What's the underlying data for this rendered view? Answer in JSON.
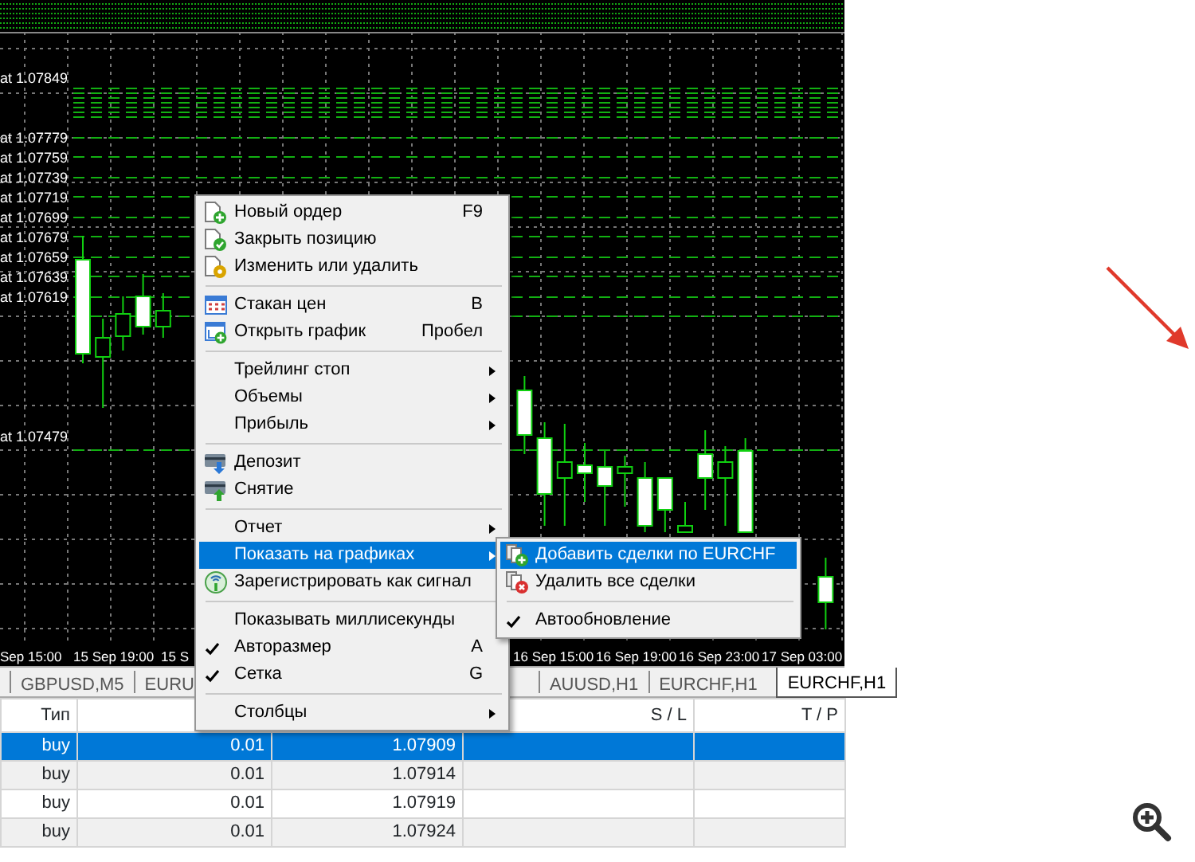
{
  "chart": {
    "price_labels": [
      "at 1.07849",
      "at 1.07779",
      "at 1.07759",
      "at 1.07739",
      "at 1.07719",
      "at 1.07699",
      "at 1.07679",
      "at 1.07659",
      "at 1.07639",
      "at 1.07619",
      "at 1.07479"
    ],
    "time_labels": [
      "Sep 15:00",
      "15 Sep 19:00",
      "15 S",
      "16 Sep 15:00",
      "16 Sep 19:00",
      "16 Sep 23:00",
      "17 Sep 03:00"
    ]
  },
  "tabs": [
    {
      "label": "GBPUSD,M5",
      "selected": false
    },
    {
      "label": "EURU",
      "selected": false
    },
    {
      "label": "AUUSD,H1",
      "selected": false
    },
    {
      "label": "EURCHF,H1",
      "selected": false
    },
    {
      "label": "EURCHF,H1",
      "selected": true
    }
  ],
  "table": {
    "header": {
      "column_1": "Тип",
      "column_4": "S / L",
      "column_5": "T / P"
    },
    "rows": [
      {
        "column_1": "buy",
        "column_2": "0.01",
        "column_3": "1.07909",
        "selected": true
      },
      {
        "column_1": "buy",
        "column_2": "0.01",
        "column_3": "1.07914",
        "selected": false
      },
      {
        "column_1": "buy",
        "column_2": "0.01",
        "column_3": "1.07919",
        "selected": false
      },
      {
        "column_1": "buy",
        "column_2": "0.01",
        "column_3": "1.07924",
        "selected": false
      }
    ]
  },
  "menu": {
    "items": [
      {
        "kind": "item",
        "label": "Новый ордер",
        "shortcut": "F9",
        "submenu": false,
        "checked": false,
        "selected": false
      },
      {
        "kind": "item",
        "label": "Закрыть позицию",
        "submenu": false,
        "checked": false,
        "selected": false
      },
      {
        "kind": "item",
        "label": "Изменить или удалить",
        "submenu": false,
        "checked": false,
        "selected": false
      },
      {
        "kind": "separator"
      },
      {
        "kind": "item",
        "label": "Стакан цен",
        "shortcut": "B",
        "submenu": false,
        "checked": false,
        "selected": false
      },
      {
        "kind": "item",
        "label": "Открыть график",
        "shortcut": "Пробел",
        "submenu": false,
        "checked": false,
        "selected": false
      },
      {
        "kind": "separator"
      },
      {
        "kind": "item",
        "label": "Трейлинг стоп",
        "submenu": true,
        "checked": false,
        "selected": false
      },
      {
        "kind": "item",
        "label": "Объемы",
        "submenu": true,
        "checked": false,
        "selected": false
      },
      {
        "kind": "item",
        "label": "Прибыль",
        "submenu": true,
        "checked": false,
        "selected": false
      },
      {
        "kind": "separator"
      },
      {
        "kind": "item",
        "label": "Депозит",
        "submenu": false,
        "checked": false,
        "selected": false
      },
      {
        "kind": "item",
        "label": "Снятие",
        "submenu": false,
        "checked": false,
        "selected": false
      },
      {
        "kind": "separator"
      },
      {
        "kind": "item",
        "label": "Отчет",
        "submenu": true,
        "checked": false,
        "selected": false
      },
      {
        "kind": "item",
        "label": "Показать на графиках",
        "submenu": true,
        "checked": false,
        "selected": true,
        "submenu_items": [
          {
            "kind": "item",
            "label": "Добавить сделки по EURCHF",
            "checked": false,
            "selected": true
          },
          {
            "kind": "item",
            "label": "Удалить все сделки",
            "checked": false,
            "selected": false
          },
          {
            "kind": "separator"
          },
          {
            "kind": "item",
            "label": "Автообновление",
            "checked": true,
            "selected": false
          }
        ]
      },
      {
        "kind": "item",
        "label": "Зарегистрировать как сигнал",
        "submenu": false,
        "checked": false,
        "selected": false
      },
      {
        "kind": "separator"
      },
      {
        "kind": "item",
        "label": "Показывать миллисекунды",
        "submenu": false,
        "checked": false,
        "selected": false
      },
      {
        "kind": "item",
        "label": "Авторазмер",
        "shortcut": "A",
        "submenu": false,
        "checked": true,
        "selected": false
      },
      {
        "kind": "item",
        "label": "Сетка",
        "shortcut": "G",
        "submenu": false,
        "checked": true,
        "selected": false
      },
      {
        "kind": "separator"
      },
      {
        "kind": "item",
        "label": "Столбцы",
        "submenu": true,
        "checked": false,
        "selected": false
      }
    ]
  }
}
